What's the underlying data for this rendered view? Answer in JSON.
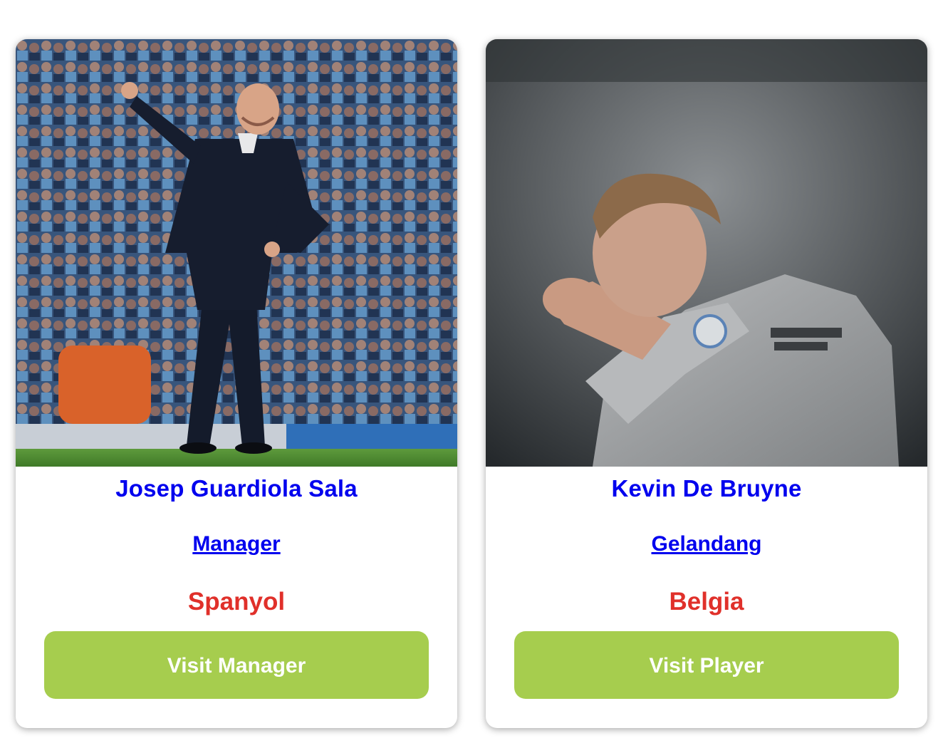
{
  "cards": [
    {
      "photo": "manager-photo",
      "name": "Josep Guardiola Sala",
      "role": "Manager",
      "country": "Spanyol",
      "button": "Visit Manager"
    },
    {
      "photo": "player-photo",
      "name": "Kevin De Bruyne",
      "role": "Gelandang",
      "country": "Belgia",
      "button": "Visit Player"
    }
  ],
  "colors": {
    "name": "#0000ee",
    "country": "#e0302a",
    "button": "#a6cd4e",
    "button_text": "#ffffff"
  }
}
